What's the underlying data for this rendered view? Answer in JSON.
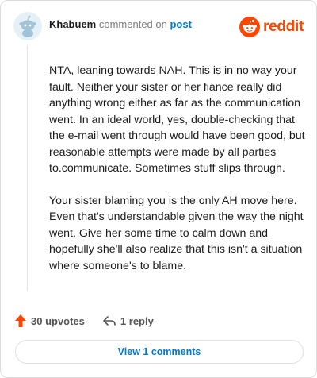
{
  "comment": {
    "author": "Khabuem",
    "verb": "commented on",
    "post_link": "post",
    "brand": "reddit",
    "paragraphs": [
      "NTA, leaning towards NAH. This is in no way your fault. Neither your sister or her fiance really did anything wrong either as far as the communication went. In an ideal world, yes, double-checking that the e-mail went through would have been good, but reasonable attempts were made by all parties to.communicate. Sometimes stuff slips through.",
      "Your sister blaming you is the only AH move here. Even that's understandable given the way the night went. Give her some time to calm down and hopefully she'll also realize that this isn't a situation where someone's to blame."
    ]
  },
  "actions": {
    "upvotes_label": "30 upvotes",
    "reply_label": "1 reply"
  },
  "footer": {
    "view_comments_label": "View 1 comments"
  },
  "icons": {
    "avatar": "snoo-avatar-icon",
    "brand": "reddit-logo-icon",
    "upvote": "upvote-arrow-icon",
    "reply": "reply-arrow-icon"
  },
  "colors": {
    "brand": "#ff4500",
    "link": "#0079d3",
    "upvote": "#ff4500",
    "avatar_bg": "#e6f1f7",
    "snoo_body": "#a0c3d8"
  }
}
